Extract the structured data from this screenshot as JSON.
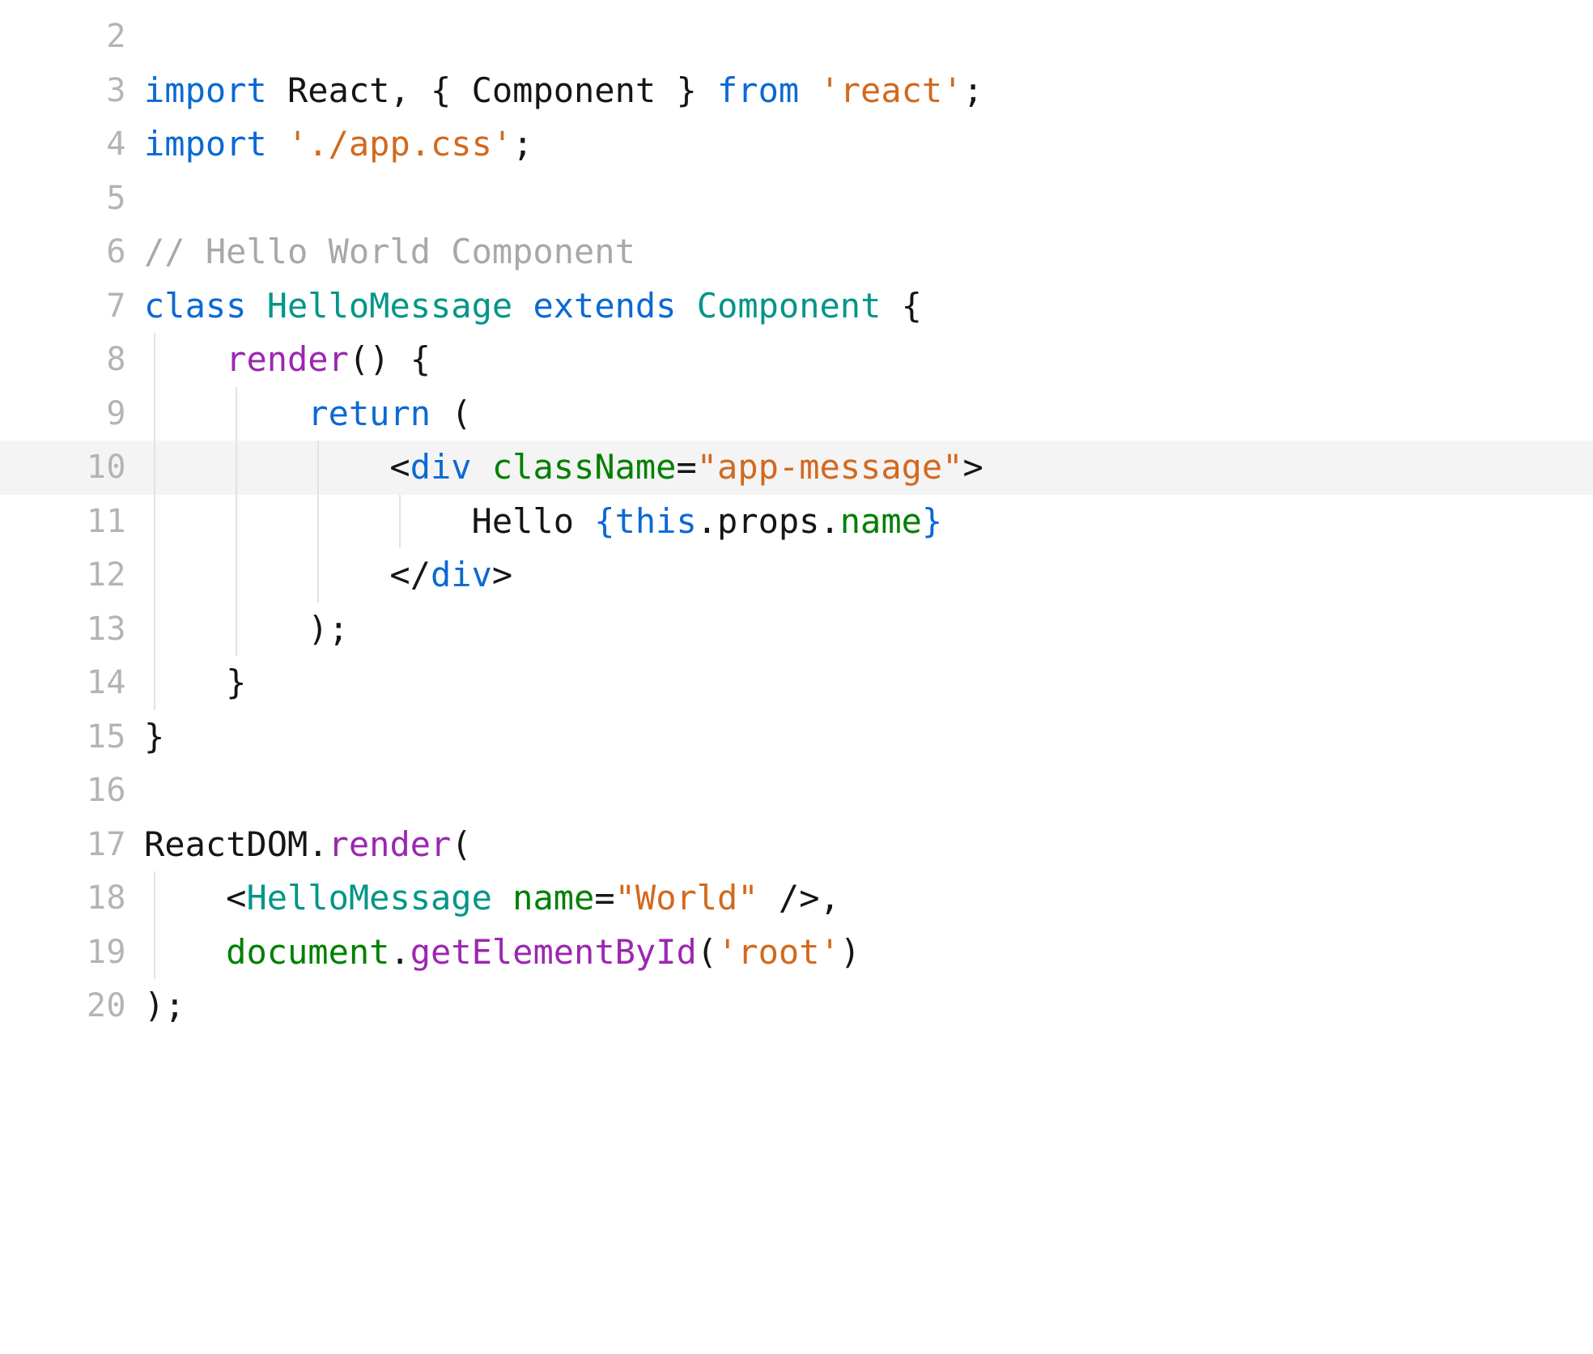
{
  "editor": {
    "language": "jsx",
    "theme": "light",
    "highlighted_line": 10,
    "colors": {
      "background": "#ffffff",
      "highlight_band": "#f4f4f4",
      "gutter_text": "#b4b4b4",
      "indent_guide": "#e2e2e2",
      "keyword": "#0b69d4",
      "class_name": "#009688",
      "method": "#9c27b0",
      "string": "#d2691e",
      "attribute": "#008000",
      "comment": "#a8a8a8",
      "plain": "#151515"
    }
  },
  "lines": [
    {
      "number": "2",
      "guides": [],
      "tokens": []
    },
    {
      "number": "3",
      "guides": [],
      "tokens": [
        {
          "t": "import",
          "c": "keyword"
        },
        {
          "t": " React, { Component } ",
          "c": "plain"
        },
        {
          "t": "from",
          "c": "keyword"
        },
        {
          "t": " ",
          "c": "plain"
        },
        {
          "t": "'react'",
          "c": "string"
        },
        {
          "t": ";",
          "c": "plain"
        }
      ]
    },
    {
      "number": "4",
      "guides": [],
      "tokens": [
        {
          "t": "import",
          "c": "keyword"
        },
        {
          "t": " ",
          "c": "plain"
        },
        {
          "t": "'./app.css'",
          "c": "string"
        },
        {
          "t": ";",
          "c": "plain"
        }
      ]
    },
    {
      "number": "5",
      "guides": [],
      "tokens": []
    },
    {
      "number": "6",
      "guides": [],
      "tokens": [
        {
          "t": "// Hello World Component",
          "c": "comment"
        }
      ]
    },
    {
      "number": "7",
      "guides": [],
      "tokens": [
        {
          "t": "class",
          "c": "keyword"
        },
        {
          "t": " ",
          "c": "plain"
        },
        {
          "t": "HelloMessage",
          "c": "class_name"
        },
        {
          "t": " ",
          "c": "plain"
        },
        {
          "t": "extends",
          "c": "keyword"
        },
        {
          "t": " ",
          "c": "plain"
        },
        {
          "t": "Component",
          "c": "class_name"
        },
        {
          "t": " {",
          "c": "plain"
        }
      ]
    },
    {
      "number": "8",
      "guides": [
        1
      ],
      "tokens": [
        {
          "t": "    ",
          "c": "plain"
        },
        {
          "t": "render",
          "c": "method"
        },
        {
          "t": "() {",
          "c": "plain"
        }
      ]
    },
    {
      "number": "9",
      "guides": [
        1,
        2
      ],
      "tokens": [
        {
          "t": "        ",
          "c": "plain"
        },
        {
          "t": "return",
          "c": "keyword"
        },
        {
          "t": " (",
          "c": "plain"
        }
      ]
    },
    {
      "number": "10",
      "guides": [
        1,
        2,
        3
      ],
      "tokens": [
        {
          "t": "            <",
          "c": "plain"
        },
        {
          "t": "div",
          "c": "keyword"
        },
        {
          "t": " ",
          "c": "plain"
        },
        {
          "t": "className",
          "c": "attribute"
        },
        {
          "t": "=",
          "c": "plain"
        },
        {
          "t": "\"app-message\"",
          "c": "string"
        },
        {
          "t": ">",
          "c": "plain"
        }
      ]
    },
    {
      "number": "11",
      "guides": [
        1,
        2,
        3,
        4
      ],
      "tokens": [
        {
          "t": "                Hello ",
          "c": "plain"
        },
        {
          "t": "{",
          "c": "keyword"
        },
        {
          "t": "this",
          "c": "keyword"
        },
        {
          "t": ".props.",
          "c": "plain"
        },
        {
          "t": "name",
          "c": "attribute"
        },
        {
          "t": "}",
          "c": "keyword"
        }
      ]
    },
    {
      "number": "12",
      "guides": [
        1,
        2,
        3
      ],
      "tokens": [
        {
          "t": "            </",
          "c": "plain"
        },
        {
          "t": "div",
          "c": "keyword"
        },
        {
          "t": ">",
          "c": "plain"
        }
      ]
    },
    {
      "number": "13",
      "guides": [
        1,
        2
      ],
      "tokens": [
        {
          "t": "        );",
          "c": "plain"
        }
      ]
    },
    {
      "number": "14",
      "guides": [
        1
      ],
      "tokens": [
        {
          "t": "    }",
          "c": "plain"
        }
      ]
    },
    {
      "number": "15",
      "guides": [],
      "tokens": [
        {
          "t": "}",
          "c": "plain"
        }
      ]
    },
    {
      "number": "16",
      "guides": [],
      "tokens": []
    },
    {
      "number": "17",
      "guides": [],
      "tokens": [
        {
          "t": "ReactDOM",
          "c": "plain"
        },
        {
          "t": ".",
          "c": "plain"
        },
        {
          "t": "render",
          "c": "method"
        },
        {
          "t": "(",
          "c": "plain"
        }
      ]
    },
    {
      "number": "18",
      "guides": [
        1
      ],
      "tokens": [
        {
          "t": "    <",
          "c": "plain"
        },
        {
          "t": "HelloMessage",
          "c": "class_name"
        },
        {
          "t": " ",
          "c": "plain"
        },
        {
          "t": "name",
          "c": "attribute"
        },
        {
          "t": "=",
          "c": "plain"
        },
        {
          "t": "\"World\"",
          "c": "string"
        },
        {
          "t": " />,",
          "c": "plain"
        }
      ]
    },
    {
      "number": "19",
      "guides": [
        1
      ],
      "tokens": [
        {
          "t": "    ",
          "c": "plain"
        },
        {
          "t": "document",
          "c": "attribute"
        },
        {
          "t": ".",
          "c": "plain"
        },
        {
          "t": "getElementById",
          "c": "method"
        },
        {
          "t": "(",
          "c": "plain"
        },
        {
          "t": "'root'",
          "c": "string"
        },
        {
          "t": ")",
          "c": "plain"
        }
      ]
    },
    {
      "number": "20",
      "guides": [],
      "tokens": [
        {
          "t": ");",
          "c": "plain"
        }
      ]
    }
  ]
}
